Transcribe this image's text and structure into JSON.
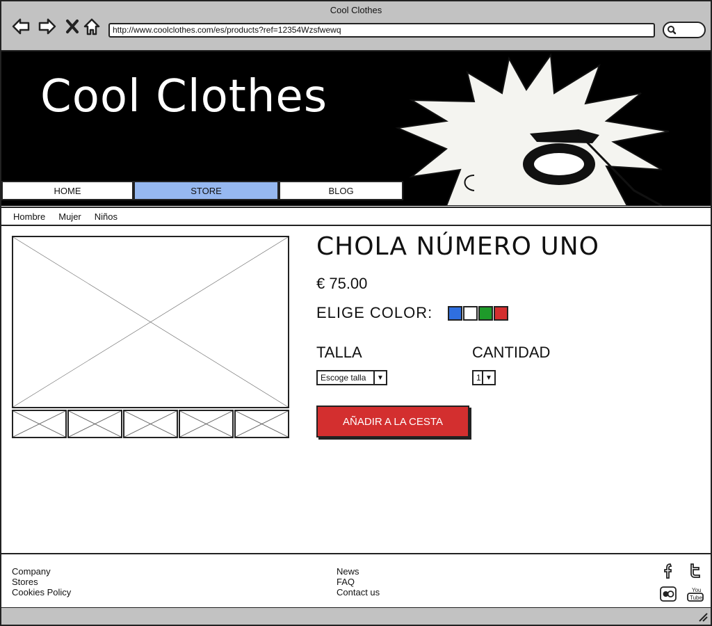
{
  "window": {
    "title": "Cool Clothes"
  },
  "browser": {
    "url": "http://www.coolclothes.com/es/products?ref=12354Wzsfwewq"
  },
  "header": {
    "logo": "Cool Clothes"
  },
  "topnav": {
    "home": "HOME",
    "store": "STORE",
    "blog": "BLOG",
    "active": "STORE"
  },
  "subnav": {
    "items": [
      "Hombre",
      "Mujer",
      "Niños"
    ]
  },
  "product": {
    "title": "CHOLA NÚMERO UNO",
    "price": "€ 75.00",
    "color_label": "ELIGE COLOR:",
    "colors": [
      "#2f6fe0",
      "#ffffff",
      "#1e9a2a",
      "#d32f2f"
    ],
    "size_label": "TALLA",
    "size_select": "Escoge talla",
    "qty_label": "CANTIDAD",
    "qty_select": "1",
    "add_button": "AÑADIR A LA CESTA"
  },
  "footer": {
    "col1": [
      "Company",
      "Stores",
      "Cookies Policy"
    ],
    "col2": [
      "News",
      "FAQ",
      "Contact us"
    ],
    "social": [
      "facebook-icon",
      "twitter-icon",
      "flickr-icon",
      "youtube-icon"
    ]
  },
  "colors": {
    "accent": "#96b8f0",
    "button": "#d32f2f",
    "chrome": "#c2c2c2"
  }
}
